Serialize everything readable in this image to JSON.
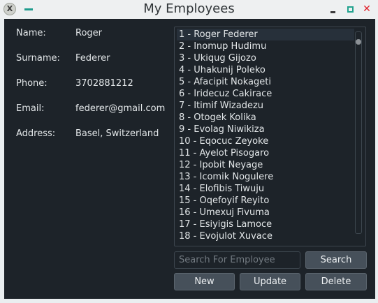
{
  "window": {
    "title": "My Employees",
    "app_icon_glyph": "X",
    "close_glyph": "✕"
  },
  "details": {
    "name_label": "Name:",
    "name_value": "Roger",
    "surname_label": "Surname:",
    "surname_value": "Federer",
    "phone_label": "Phone:",
    "phone_value": "3702881212",
    "email_label": "Email:",
    "email_value": "federer@gmail.com",
    "address_label": "Address:",
    "address_value": "Basel, Switzerland"
  },
  "employees": [
    "1 - Roger Federer",
    "2 - Inomup Hudimu",
    "3 - Ukiqug Gijozo",
    "4 - Uhakunij Poleko",
    "5 - Afacipit Nokageti",
    "6 - Iridecuz Cakirace",
    "7 - Itimif Wizadezu",
    "8 - Otogek Kolika",
    "9 - Evolag Niwikiza",
    "10 - Eqocuc Zeyoke",
    "11 - Ayelot Pisogaro",
    "12 - Ipobit Neyage",
    "13 - Icomik Nogulere",
    "14 - Elofibis Tiwuju",
    "15 - Oqefoyif Reyito",
    "16 - Umexuj Fivuma",
    "17 - Esiyigis Lamoce",
    "18 - Evojulot Xuvace"
  ],
  "selected_index": 0,
  "search": {
    "placeholder": "Search For Employee",
    "value": ""
  },
  "buttons": {
    "search": "Search",
    "new": "New",
    "update": "Update",
    "delete": "Delete"
  },
  "colors": {
    "panel_bg": "#1d2329",
    "button_bg": "#46505a",
    "accent": "#1f9c8d",
    "close": "#e0202a"
  }
}
